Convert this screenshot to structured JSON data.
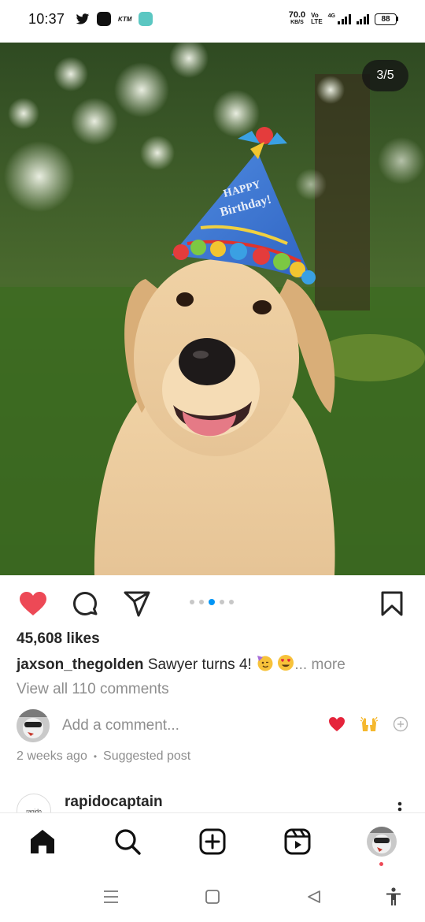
{
  "status_bar": {
    "time": "10:37",
    "left_icons": [
      "twitter-icon",
      "app-icon",
      "ktm-icon",
      "messenger-icon"
    ],
    "ktm_text": "KTM",
    "speed_value": "70.0",
    "speed_unit": "KB/S",
    "volte_top": "Vo",
    "volte_bottom": "LTE",
    "network": "4G",
    "battery": "88"
  },
  "post": {
    "slide_counter": "3/5",
    "slide_index": 3,
    "slide_total": 5,
    "liked": true,
    "likes": "45,608 likes",
    "caption_user": "jaxson_thegolden",
    "caption_text": "Sawyer turns 4!",
    "caption_emojis": [
      "partying-face-emoji",
      "heart-eyes-emoji"
    ],
    "caption_more": "... more",
    "view_comments": "View all 110 comments",
    "add_comment_placeholder": "Add a comment...",
    "quick_reactions": [
      "heart-emoji",
      "raised-hands-emoji",
      "add-emoji"
    ],
    "time_ago": "2 weeks ago",
    "separator": "•",
    "suggested": "Suggested post"
  },
  "next_post": {
    "avatar_text": "rapido",
    "username": "rapidocaptain"
  },
  "bottom_nav": [
    "home-icon",
    "search-icon",
    "create-icon",
    "reels-icon",
    "profile-avatar"
  ],
  "system_nav": [
    "menu-icon",
    "home-square-icon",
    "back-icon",
    "accessibility-icon"
  ],
  "colors": {
    "like_red": "#ed4956",
    "accent_blue": "#0095f6",
    "muted_text": "#8e8e8e",
    "primary_text": "#262626"
  }
}
